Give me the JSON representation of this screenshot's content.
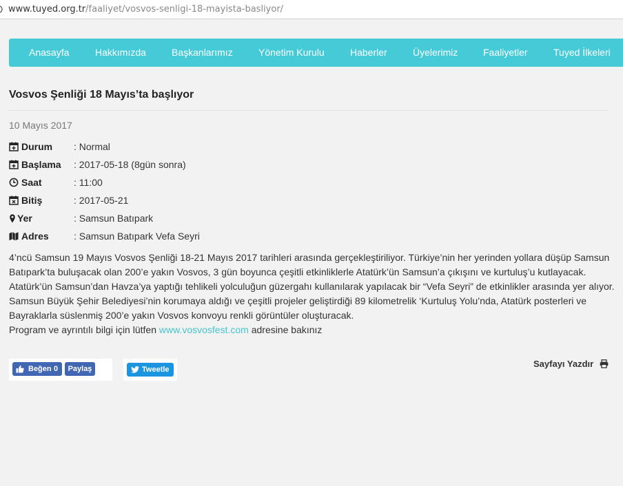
{
  "browser": {
    "url_host": "www.tuyed.org.tr",
    "url_path": "/faaliyet/vosvos-senligi-18-mayista-basliyor/"
  },
  "nav": {
    "items": [
      "Anasayfa",
      "Hakkımızda",
      "Başkanlarımız",
      "Yönetim Kurulu",
      "Haberler",
      "Üyelerimiz",
      "Faaliyetler",
      "Tuyed İlkeleri"
    ]
  },
  "article": {
    "title": "Vosvos Şenliği 18 Mayıs’ta başlıyor",
    "date": "10 Mayıs 2017",
    "info": [
      {
        "icon": "calendar-plus-icon",
        "label": "Durum",
        "value": ": Normal"
      },
      {
        "icon": "calendar-plus-icon",
        "label": "Başlama",
        "value": ": 2017-05-18 (8gün sonra)"
      },
      {
        "icon": "clock-icon",
        "label": "Saat",
        "value": ": 11:00"
      },
      {
        "icon": "calendar-times-icon",
        "label": "Bitiş",
        "value": ": 2017-05-21"
      },
      {
        "icon": "map-marker-icon",
        "label": "Yer",
        "value": ": Samsun Batıpark"
      },
      {
        "icon": "map-icon",
        "label": "Adres",
        "value": ": Samsun Batıpark Vefa Seyri"
      }
    ],
    "paragraph1": "4’ncü Samsun 19 Mayıs Vosvos Şenliği 18-21 Mayıs 2017 tarihleri arasında gerçekleştiriliyor. Türkiye’nin her yerinden yollara düşüp Samsun Batıpark’ta buluşacak olan 200’e yakın Vosvos, 3 gün boyunca çeşitli etkinliklerle Atatürk’ün Samsun’a çıkışını ve kurtuluş’u kutlayacak.",
    "paragraph2": "Atatürk’ün Samsun’dan Havza’ya yaptığı tehlikeli yolculuğun güzergahı kullanılarak yapılacak bir “Vefa Seyri” de etkinlikler arasında yer alıyor. Samsun Büyük Şehir Belediyesi’nin korumaya aldığı ve çeşitli projeler geliştirdiği 89 kilometrelik ‘Kurtuluş Yolu’nda, Atatürk posterleri ve Bayraklarla süslenmiş 200’e yakın Vosvos konvoyu renkli görüntüler oluşturacak.",
    "program_prefix": "Program ve ayrıntılı bilgi için lütfen",
    "program_link": "www.vosvosfest.com",
    "program_suffix": "adresine bakınız"
  },
  "social": {
    "like_label": "Beğen",
    "like_count": "0",
    "share_label": "Paylaş",
    "tweet_label": "Tweetle"
  },
  "print": {
    "label": "Sayfayı Yazdır"
  },
  "colors": {
    "nav_bg": "#45cbd8",
    "link": "#45c4cf",
    "facebook": "#4267b2",
    "twitter": "#1b95e0"
  }
}
